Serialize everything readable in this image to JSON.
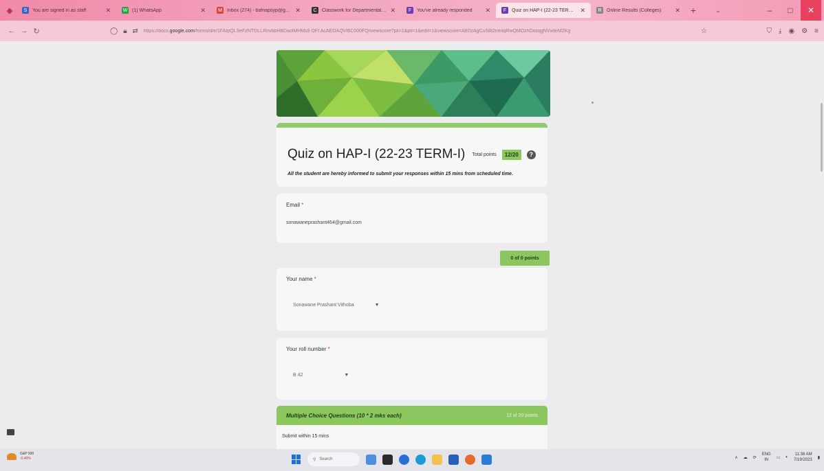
{
  "browser": {
    "tabs": [
      {
        "label": "You are signed in as staff",
        "favicon_color": "#3a63c7",
        "favicon_text": "S"
      },
      {
        "label": "(1) WhatsApp",
        "favicon_color": "#25a244",
        "favicon_text": "W"
      },
      {
        "label": "Inbox (274) - bafnapsyp@g...",
        "favicon_color": "#d44638",
        "favicon_text": "M"
      },
      {
        "label": "Classwork for Departmental (...",
        "favicon_color": "#333333",
        "favicon_text": "C"
      },
      {
        "label": "You've already responded",
        "favicon_color": "#6a3fb5",
        "favicon_text": "F"
      },
      {
        "label": "Quiz on HAP-I (22-23 TERM-I)",
        "favicon_color": "#6a3fb5",
        "favicon_text": "F"
      },
      {
        "label": "Online Results (Colleges)",
        "favicon_color": "#888888",
        "favicon_text": "R"
      }
    ],
    "url": {
      "prefix": "https://docs.",
      "domain": "google.com",
      "path": "/forms/d/e/1FAIpQLSeFzNTDLLRnvbbHBDaolMHMs9 OFI AcAEOAQVI6C000FQ/viewscore?pli=1&pli=1&edit=1&viewscore=AE0zAgCuS8t2nmtqRwQMOzhDozqgNVvdeM2Kg"
    },
    "window_controls": {
      "minimize": "–",
      "maximize": "□",
      "close": "✕"
    }
  },
  "form": {
    "title": "Quiz on HAP-I (22-23 TERM-I)",
    "total_points_label": "Total points",
    "total_points_value": "12/20",
    "description": "All the student are hereby informed to submit your responses within 15 mins from scheduled time.",
    "email_label": "Email",
    "email_value": "sonawaneprashant464@gmail.com",
    "required_mark": "*",
    "score_badge": "0 of 0 points",
    "name_question": "Your name",
    "name_value": "Sonawane Prashant Vithoba",
    "roll_question": "Your roll number",
    "roll_value": "B 42",
    "section_title": "Multiple Choice Questions (10 * 2 mks each)",
    "section_points": "12 of 20 points",
    "section_description": "Submit within 15 mins"
  },
  "taskbar": {
    "weather_index": "G&P 500",
    "weather_change": "-0.40%",
    "search_placeholder": "Search",
    "lang_line1": "ENG",
    "lang_line2": "IN",
    "time": "11:38 AM",
    "date": "7/19/2023"
  },
  "colors": {
    "accent_green": "#8cc65e",
    "tab_strip_pink": "#f08aa8",
    "toolbar_pink": "#f6c9d6"
  }
}
